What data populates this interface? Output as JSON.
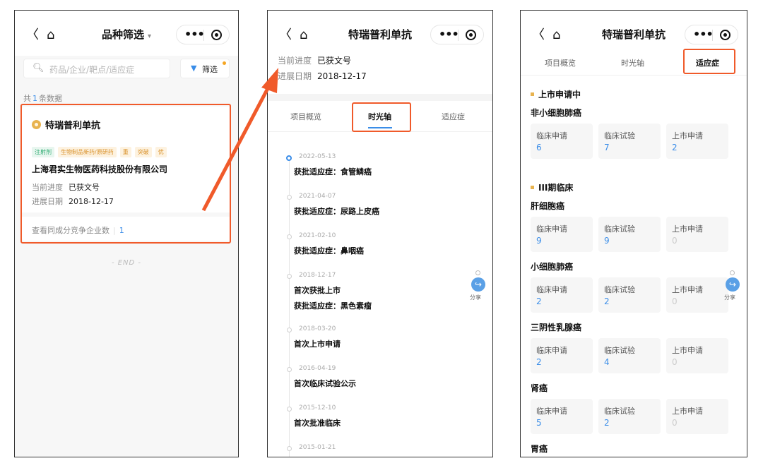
{
  "phone1": {
    "nav": {
      "title": "品种筛选",
      "caret": "▾",
      "back": "〈",
      "home": "⌂"
    },
    "search": {
      "placeholder": "药品/企业/靶点/适应症"
    },
    "filter": {
      "label": "筛选"
    },
    "count": {
      "prefix": "共",
      "num": "1",
      "suffix": "条数据"
    },
    "card": {
      "title": "特瑞普利单抗",
      "tags": [
        {
          "text": "注射剂",
          "color": "green"
        },
        {
          "text": "生物制品新药/原研药",
          "color": "orange"
        },
        {
          "text": "重",
          "color": "orange"
        },
        {
          "text": "突破",
          "color": "orange"
        },
        {
          "text": "优",
          "color": "orange"
        }
      ],
      "company": "上海君实生物医药科技股份有限公司",
      "progress_label": "当前进度",
      "progress_value": "已获文号",
      "date_label": "进展日期",
      "date_value": "2018-12-17",
      "footer_label": "查看同成分竞争企业数",
      "footer_num": "1"
    },
    "end_text": "- END -"
  },
  "phone2": {
    "nav": {
      "title": "特瑞普利单抗",
      "back": "〈",
      "home": "⌂"
    },
    "progress_label": "当前进度",
    "progress_value": "已获文号",
    "date_label": "进展日期",
    "date_value": "2018-12-17",
    "tabs": [
      "项目概览",
      "时光轴",
      "适应症"
    ],
    "active_tab": "时光轴",
    "timeline": [
      {
        "date": "2022-05-13",
        "events": [
          "获批适应症：食管鳞癌"
        ]
      },
      {
        "date": "2021-04-07",
        "events": [
          "获批适应症：尿路上皮癌"
        ]
      },
      {
        "date": "2021-02-10",
        "events": [
          "获批适应症：鼻咽癌"
        ]
      },
      {
        "date": "2018-12-17",
        "events": [
          "首次获批上市",
          "获批适应症：黑色素瘤"
        ]
      },
      {
        "date": "2018-03-20",
        "events": [
          "首次上市申请"
        ]
      },
      {
        "date": "2016-04-19",
        "events": [
          "首次临床试验公示"
        ]
      },
      {
        "date": "2015-12-10",
        "events": [
          "首次批准临床"
        ]
      },
      {
        "date": "2015-01-21",
        "events": []
      }
    ],
    "share_label": "分享"
  },
  "phone3": {
    "nav": {
      "title": "特瑞普利单抗",
      "back": "〈",
      "home": "⌂"
    },
    "tabs": [
      "项目概览",
      "时光轴",
      "适应症"
    ],
    "active_tab": "适应症",
    "sections": [
      {
        "title": "上市申请中",
        "diseases": [
          {
            "name": "非小细胞肺癌",
            "stats": [
              {
                "label": "临床申请",
                "value": "6"
              },
              {
                "label": "临床试验",
                "value": "7"
              },
              {
                "label": "上市申请",
                "value": "2"
              }
            ]
          }
        ]
      },
      {
        "title": "III期临床",
        "diseases": [
          {
            "name": "肝细胞癌",
            "stats": [
              {
                "label": "临床申请",
                "value": "9"
              },
              {
                "label": "临床试验",
                "value": "9"
              },
              {
                "label": "上市申请",
                "value": "0"
              }
            ]
          },
          {
            "name": "小细胞肺癌",
            "stats": [
              {
                "label": "临床申请",
                "value": "2"
              },
              {
                "label": "临床试验",
                "value": "2"
              },
              {
                "label": "上市申请",
                "value": "0"
              }
            ]
          },
          {
            "name": "三阴性乳腺癌",
            "stats": [
              {
                "label": "临床申请",
                "value": "2"
              },
              {
                "label": "临床试验",
                "value": "4"
              },
              {
                "label": "上市申请",
                "value": "0"
              }
            ]
          },
          {
            "name": "肾癌",
            "stats": [
              {
                "label": "临床申请",
                "value": "5"
              },
              {
                "label": "临床试验",
                "value": "2"
              },
              {
                "label": "上市申请",
                "value": "0"
              }
            ]
          },
          {
            "name": "胃癌",
            "stats": []
          }
        ]
      }
    ],
    "share_label": "分享"
  },
  "colors": {
    "accent": "#3a8de8",
    "highlight": "#f05a2a",
    "section_marker": "#e8b34f"
  },
  "icons": {
    "back": "chevron-left-icon",
    "home": "home-icon",
    "search": "search-icon",
    "filter": "filter-icon",
    "share": "share-icon",
    "more": "more-dots-icon",
    "close": "target-close-icon"
  }
}
